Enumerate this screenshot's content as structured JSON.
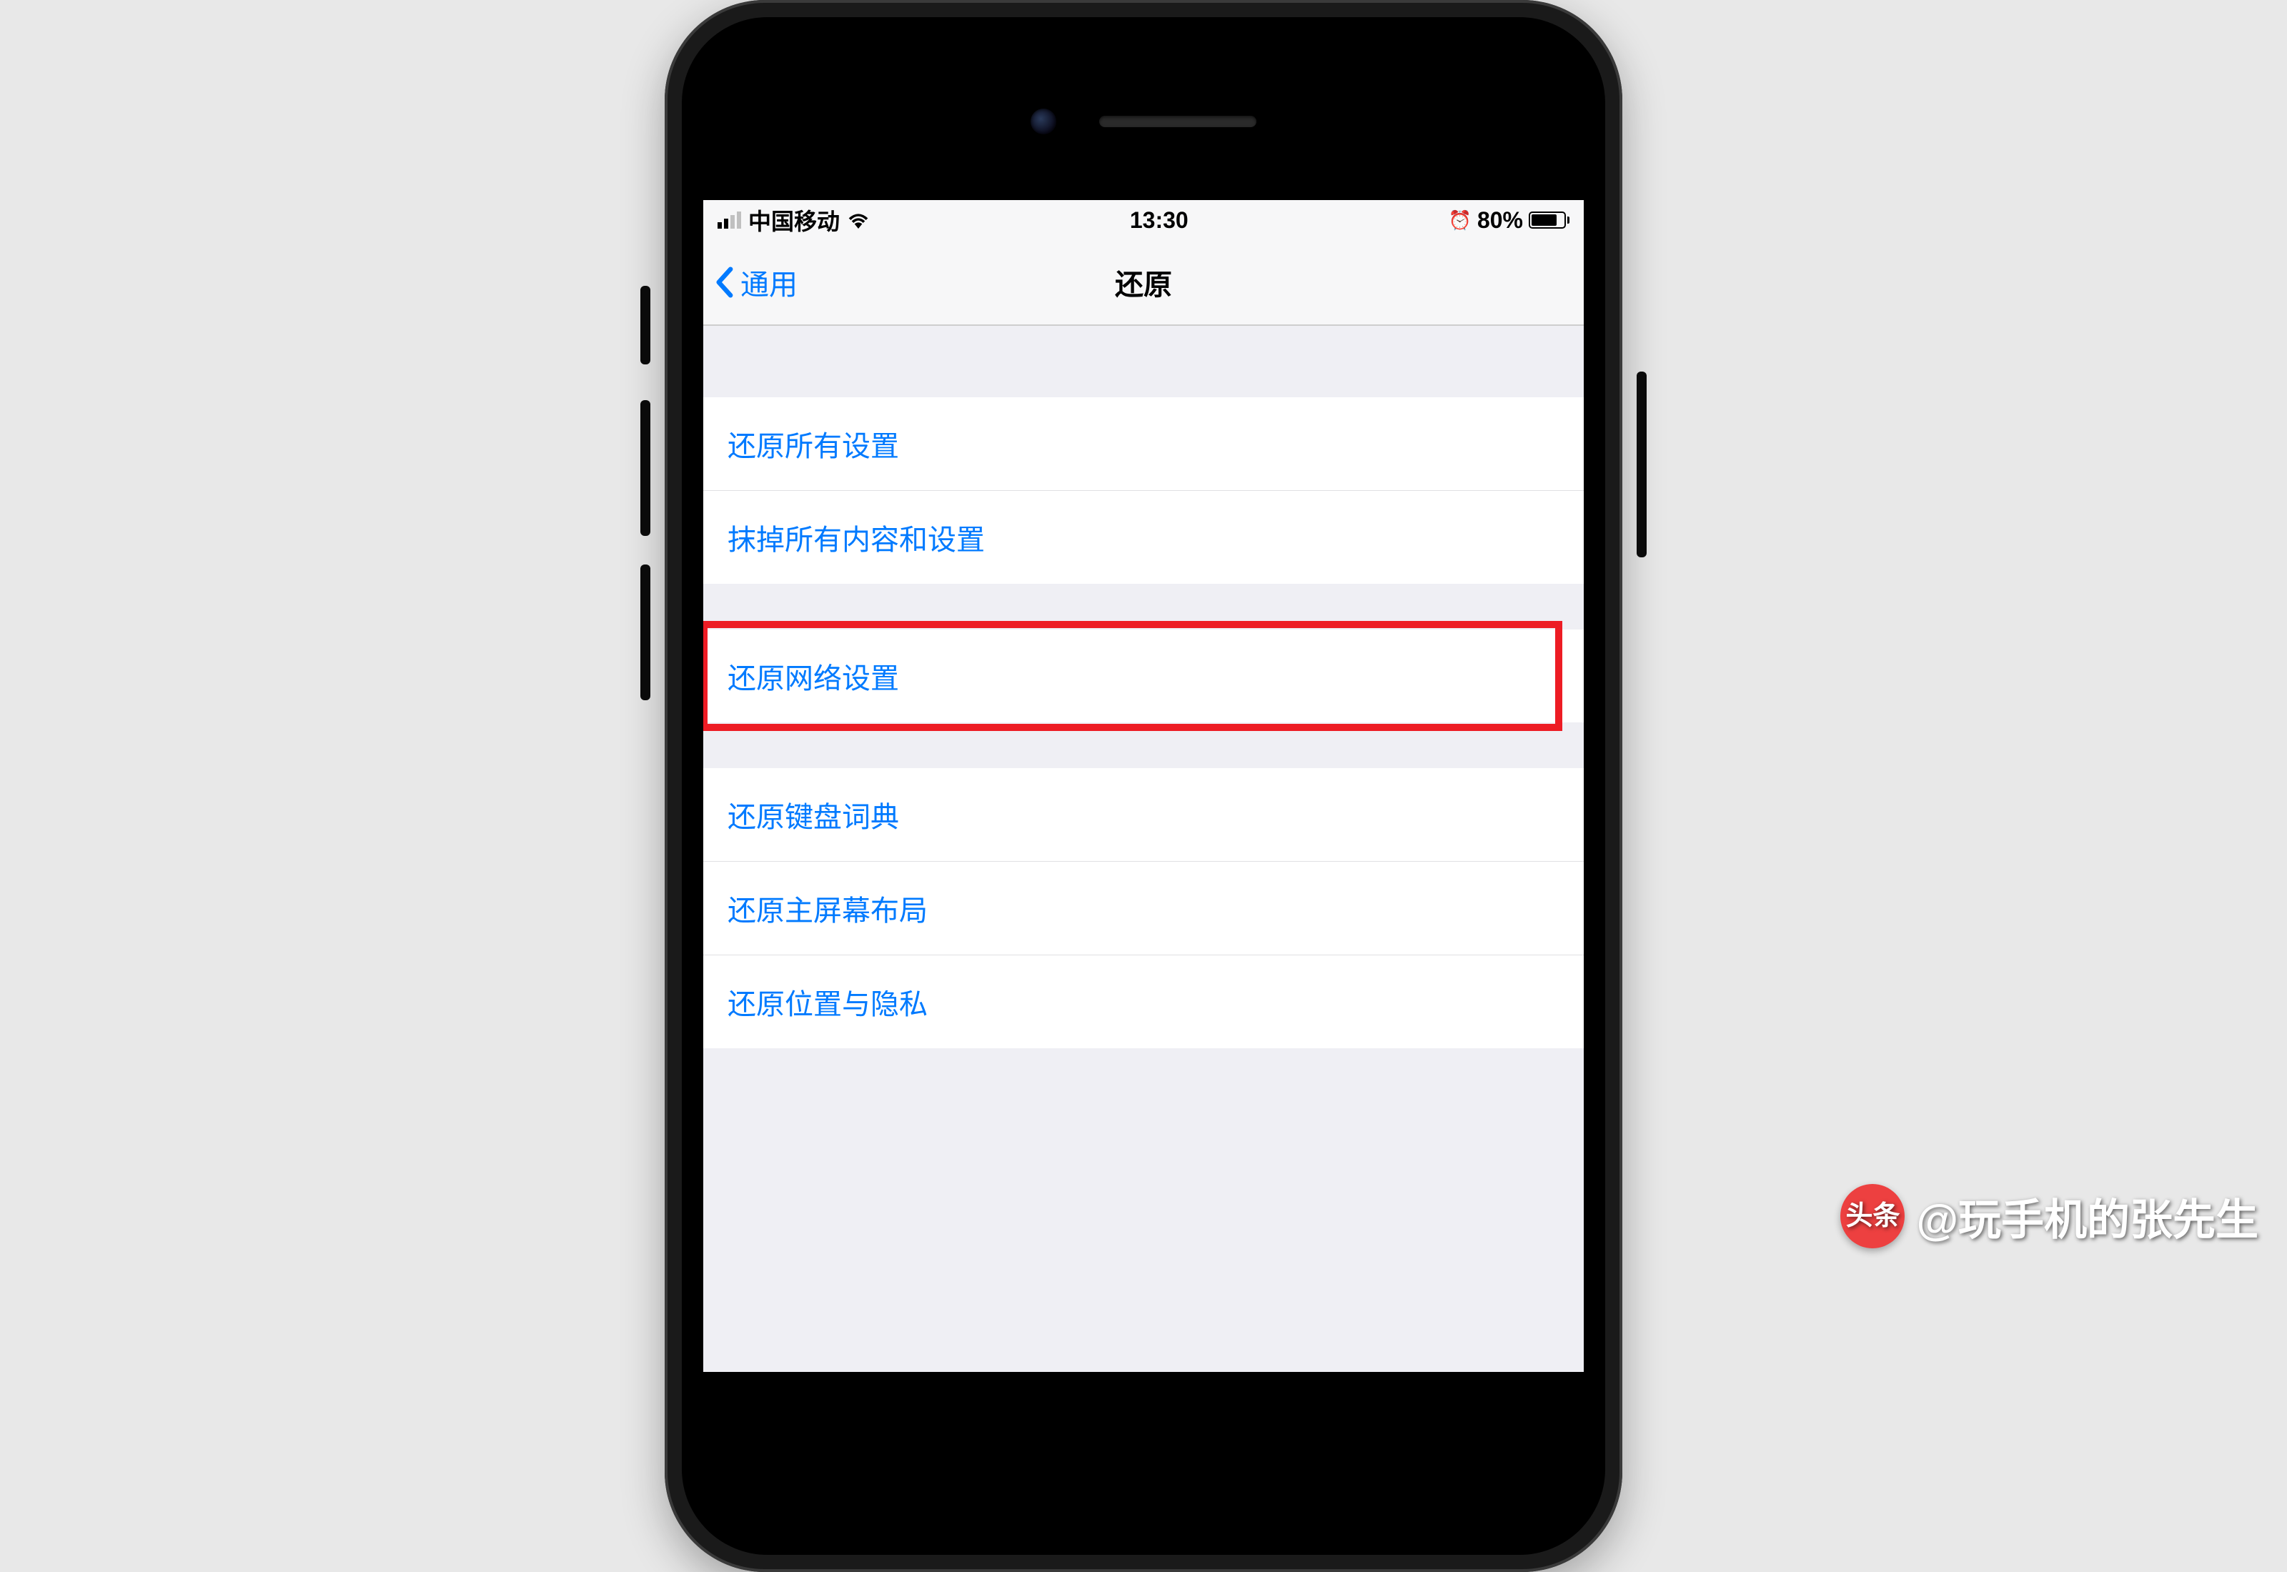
{
  "statusBar": {
    "carrier": "中国移动",
    "time": "13:30",
    "batteryPercent": "80%"
  },
  "navBar": {
    "backLabel": "通用",
    "title": "还原"
  },
  "sections": [
    {
      "items": [
        {
          "label": "还原所有设置"
        },
        {
          "label": "抹掉所有内容和设置"
        }
      ]
    },
    {
      "items": [
        {
          "label": "还原网络设置",
          "highlighted": true
        }
      ]
    },
    {
      "items": [
        {
          "label": "还原键盘词典"
        },
        {
          "label": "还原主屏幕布局"
        },
        {
          "label": "还原位置与隐私"
        }
      ]
    }
  ],
  "watermark": {
    "logoText": "头条",
    "text": "@玩手机的张先生"
  }
}
